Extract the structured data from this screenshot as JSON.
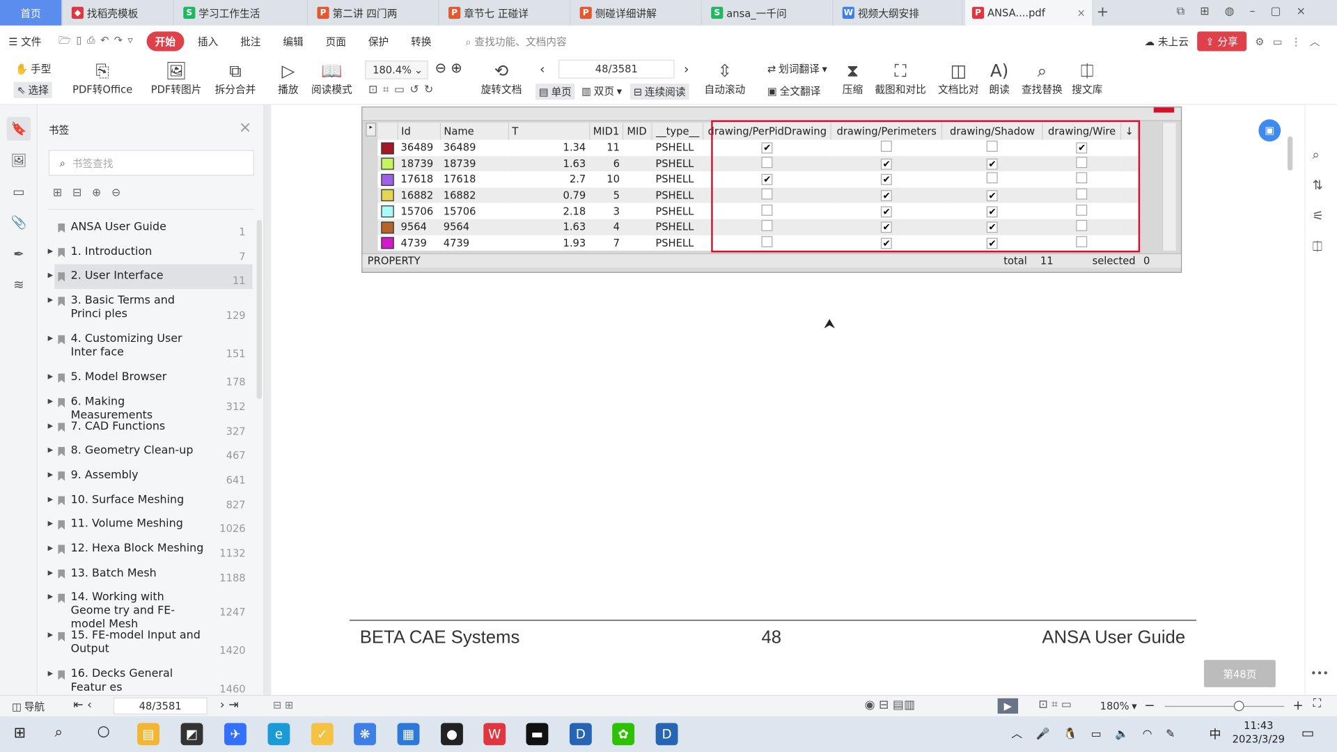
{
  "tabs": [
    {
      "label": "首页",
      "icon": "",
      "color": "#5b8def"
    },
    {
      "label": "找稻壳模板",
      "icon": "docer-icon",
      "color": "#e0363f"
    },
    {
      "label": "学习工作生活",
      "icon": "S",
      "color": "#1fb861"
    },
    {
      "label": "第二讲 四门两",
      "icon": "P",
      "color": "#e5582f"
    },
    {
      "label": "章节七 正碰详",
      "icon": "P",
      "color": "#e5582f"
    },
    {
      "label": "侧碰详细讲解",
      "icon": "P",
      "color": "#e5582f"
    },
    {
      "label": "ansa_一千问",
      "icon": "S",
      "color": "#1fb861"
    },
    {
      "label": "视频大纲安排",
      "icon": "W",
      "color": "#3f7fe8"
    },
    {
      "label": "ANSA....pdf",
      "icon": "pdf",
      "color": "#e0363f"
    }
  ],
  "menu": {
    "file": "文件",
    "items": [
      "开始",
      "插入",
      "批注",
      "编辑",
      "页面",
      "保护",
      "转换"
    ],
    "search_placeholder": "查找功能、文档内容",
    "cloud": "未上云",
    "share": "分享"
  },
  "ribbon": {
    "hand": "手型",
    "select": "选择",
    "pdf_office": "PDF转Office",
    "pdf_image": "PDF转图片",
    "split_merge": "拆分合并",
    "play": "播放",
    "read_mode": "阅读模式",
    "zoom": "180.4%",
    "rotate": "旋转文档",
    "page": "48/3581",
    "single": "单页",
    "double": "双页",
    "continuous": "连续阅读",
    "auto_scroll": "自动滚动",
    "word_translate": "划词翻译",
    "full_translate": "全文翻译",
    "compress": "压缩",
    "screenshot_compare": "截图和对比",
    "doc_compare": "文档比对",
    "read_aloud": "朗读",
    "find_replace": "查找替换",
    "search_lib": "搜文库"
  },
  "sidebar": {
    "title": "书签",
    "search_placeholder": "书签查找",
    "bookmarks": [
      {
        "title": "ANSA User Guide",
        "page": "1",
        "expand": false
      },
      {
        "title": "1. Introduction",
        "page": "7",
        "expand": true
      },
      {
        "title": "2. User Interface",
        "page": "11",
        "expand": true,
        "selected": true
      },
      {
        "title": "3. Basic Terms and Princi ples",
        "page": "129",
        "expand": true
      },
      {
        "title": "4. Customizing User Inter face",
        "page": "151",
        "expand": true
      },
      {
        "title": "5. Model Browser",
        "page": "178",
        "expand": true
      },
      {
        "title": "6. Making Measurements",
        "page": "312",
        "expand": true
      },
      {
        "title": "7. CAD Functions",
        "page": "327",
        "expand": true
      },
      {
        "title": "8. Geometry Clean-up",
        "page": "467",
        "expand": true
      },
      {
        "title": "9. Assembly",
        "page": "641",
        "expand": true
      },
      {
        "title": "10. Surface Meshing",
        "page": "827",
        "expand": true
      },
      {
        "title": "11. Volume Meshing",
        "page": "1026",
        "expand": true
      },
      {
        "title": "12. Hexa Block Meshing",
        "page": "1132",
        "expand": true
      },
      {
        "title": "13. Batch Mesh",
        "page": "1188",
        "expand": true
      },
      {
        "title": "14. Working with Geome try and FE-model Mesh",
        "page": "1247",
        "expand": true
      },
      {
        "title": "15. FE-model Input and Output",
        "page": "1420",
        "expand": true
      },
      {
        "title": "16. Decks General Featur es",
        "page": "1460",
        "expand": true
      }
    ]
  },
  "property_table": {
    "columns": [
      "Id",
      "Name",
      "T",
      "MID1",
      "MID",
      "__type__",
      "drawing/PerPidDrawing",
      "drawing/Perimeters",
      "drawing/Shadow",
      "drawing/Wire"
    ],
    "rows": [
      {
        "color": "#a11a2a",
        "id": "36489",
        "name": "36489",
        "t": "1.34",
        "mid1": "11",
        "mid": "",
        "type": "PSHELL",
        "checks": [
          true,
          false,
          false,
          true
        ]
      },
      {
        "color": "#c4f560",
        "id": "18739",
        "name": "18739",
        "t": "1.63",
        "mid1": "6",
        "mid": "",
        "type": "PSHELL",
        "checks": [
          false,
          true,
          true,
          false
        ]
      },
      {
        "color": "#9b62e8",
        "id": "17618",
        "name": "17618",
        "t": "2.7",
        "mid1": "10",
        "mid": "",
        "type": "PSHELL",
        "checks": [
          true,
          true,
          false,
          false
        ]
      },
      {
        "color": "#e4d654",
        "id": "16882",
        "name": "16882",
        "t": "0.79",
        "mid1": "5",
        "mid": "",
        "type": "PSHELL",
        "checks": [
          false,
          true,
          true,
          false
        ]
      },
      {
        "color": "#a8fbf8",
        "id": "15706",
        "name": "15706",
        "t": "2.18",
        "mid1": "3",
        "mid": "",
        "type": "PSHELL",
        "checks": [
          false,
          true,
          true,
          false
        ]
      },
      {
        "color": "#b5652c",
        "id": "9564",
        "name": "9564",
        "t": "1.63",
        "mid1": "4",
        "mid": "",
        "type": "PSHELL",
        "checks": [
          false,
          true,
          true,
          false
        ]
      },
      {
        "color": "#d21bc8",
        "id": "4739",
        "name": "4739",
        "t": "1.93",
        "mid1": "7",
        "mid": "",
        "type": "PSHELL",
        "checks": [
          false,
          true,
          true,
          false
        ]
      }
    ],
    "footer_label": "PROPERTY",
    "total_label": "total",
    "total": "11",
    "selected_label": "selected",
    "selected": "0"
  },
  "page_footer": {
    "left": "BETA CAE Systems",
    "center": "48",
    "right": "ANSA User Guide"
  },
  "page_badge": "第48页",
  "status": {
    "nav": "导航",
    "page": "48/3581",
    "zoom": "180%",
    "zoom_level": 0.62
  },
  "taskbar": {
    "time": "11:43",
    "date": "2023/3/29",
    "ime": "中"
  }
}
